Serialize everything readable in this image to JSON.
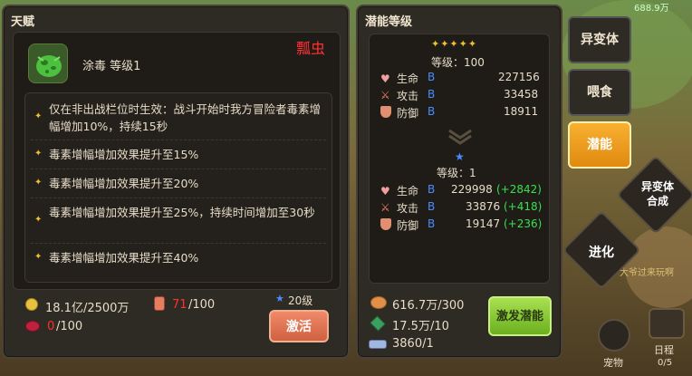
{
  "talent": {
    "title": "天赋",
    "skill_name": "涂毒 等级1",
    "watermark": "瓢虫",
    "effects": [
      "仅在非出战栏位时生效：战斗开始时我方冒险者毒素增幅增加10%，持续15秒",
      "毒素增幅增加效果提升至15%",
      "毒素增幅增加效果提升至20%",
      "毒素增幅增加效果提升至25%，持续时间增加至30秒",
      "毒素增幅增加效果提升至40%"
    ],
    "cost_gold": "18.1亿/2500万",
    "cost_potion_cur": "71",
    "cost_potion_max": "/100",
    "cost_gem_cur": "0",
    "cost_gem_max": "/100",
    "required_level": "20级",
    "activate_label": "激活"
  },
  "potential": {
    "title": "潜能等级",
    "top_stars": "✦✦✦✦✦",
    "top_level": "等级：100",
    "top_stats": [
      {
        "name": "生命",
        "grade": "B",
        "value": "227156"
      },
      {
        "name": "攻击",
        "grade": "B",
        "value": "33458"
      },
      {
        "name": "防御",
        "grade": "B",
        "value": "18911"
      }
    ],
    "bottom_level": "等级：1",
    "bottom_stats": [
      {
        "name": "生命",
        "grade": "B",
        "value": "229998",
        "bonus": "(+2842)"
      },
      {
        "name": "攻击",
        "grade": "B",
        "value": "33876",
        "bonus": "(+418)"
      },
      {
        "name": "防御",
        "grade": "B",
        "value": "19147",
        "bonus": "(+236)"
      }
    ],
    "res1": "616.7万/300",
    "res2": "17.5万/10",
    "res3": "3860/1",
    "awaken_label": "激发潜能"
  },
  "side": {
    "mutant": "异变体",
    "feed": "喂食",
    "potential": "潜能",
    "mutant_combine_1": "异变体",
    "mutant_combine_2": "合成",
    "evolve": "进化",
    "bg_text": "大爷过来玩啊",
    "pet": "宠物",
    "schedule": "日程",
    "schedule_count": "0/5",
    "top_right": "688.9万"
  },
  "colors": {
    "accent_orange": "#f0a020",
    "button_red": "#e07050",
    "button_green": "#8cd030"
  }
}
